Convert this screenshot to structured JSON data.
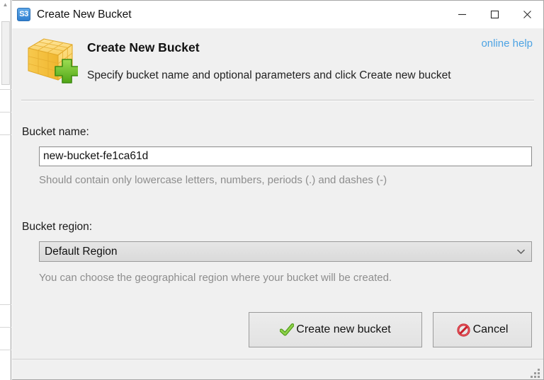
{
  "window": {
    "title": "Create New Bucket",
    "icon": "s3-icon",
    "icon_label": "S3",
    "controls": {
      "minimize": "minimize-icon",
      "maximize": "maximize-icon",
      "close": "close-icon"
    }
  },
  "header": {
    "icon": "bucket-add-icon",
    "title": "Create New Bucket",
    "subtitle": "Specify bucket name and optional parameters and click Create new bucket",
    "help_link": "online help"
  },
  "form": {
    "bucket_name": {
      "label": "Bucket name:",
      "value": "new-bucket-fe1ca61d",
      "placeholder": "",
      "hint": "Should contain only lowercase letters, numbers, periods (.) and dashes (-)"
    },
    "bucket_region": {
      "label": "Bucket region:",
      "value": "Default Region",
      "hint": "You can choose the geographical region where your bucket will be created.",
      "arrow_icon": "chevron-down-icon"
    }
  },
  "footer": {
    "create_label": "Create new bucket",
    "create_icon": "green-check-icon",
    "cancel_label": "Cancel",
    "cancel_icon": "red-prohibition-icon"
  },
  "statusbar": {
    "resize_grip": "resize-grip-icon"
  },
  "colors": {
    "link": "#4da3e3",
    "dialog_bg": "#f0f0f0",
    "hint_text": "#8d8d8d",
    "accent_green": "#6dbe2b",
    "accent_red": "#cc2229",
    "icon_yellow": "#f5c542"
  }
}
